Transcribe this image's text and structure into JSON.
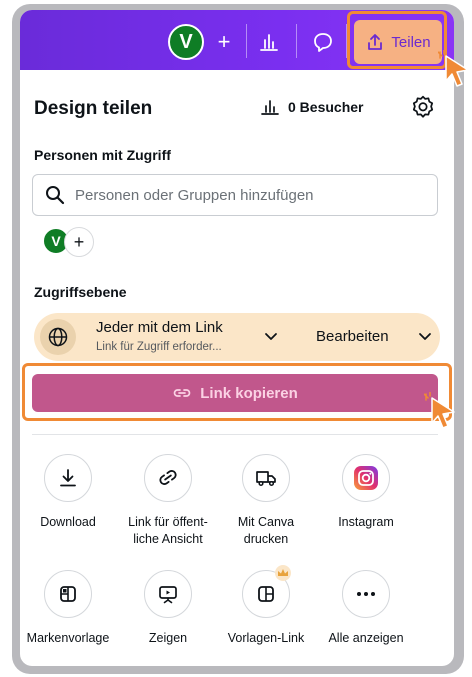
{
  "topbar": {
    "avatar_initial": "V",
    "add_label": "+",
    "share_label": "Teilen",
    "accent_color": "#7a2ff0"
  },
  "header": {
    "title": "Design teilen",
    "visitors_label": "0 Besucher"
  },
  "people": {
    "section_label": "Personen mit Zugriff",
    "search_placeholder": "Personen oder Gruppen hinzufügen",
    "avatar_initial": "V",
    "add_label": "+"
  },
  "access": {
    "section_label": "Zugriffsebene",
    "title": "Jeder mit dem Link",
    "subtitle": "Link für Zugriff erforder...",
    "permission": "Bearbeiten"
  },
  "copy_button": {
    "label": "Link kopieren",
    "color": "#c1578c"
  },
  "actions": [
    {
      "label": "Download",
      "icon": "download-icon"
    },
    {
      "label": "Link für öffent-\nliche Ansicht",
      "icon": "link-icon"
    },
    {
      "label": "Mit Canva\ndrucken",
      "icon": "truck-icon"
    },
    {
      "label": "Instagram",
      "icon": "instagram-icon"
    },
    {
      "label": "Markenvorlage",
      "icon": "brand-template-icon"
    },
    {
      "label": "Zeigen",
      "icon": "present-icon"
    },
    {
      "label": "Vorlagen-Link",
      "icon": "template-link-icon"
    },
    {
      "label": "Alle anzeigen",
      "icon": "more-icon"
    }
  ]
}
